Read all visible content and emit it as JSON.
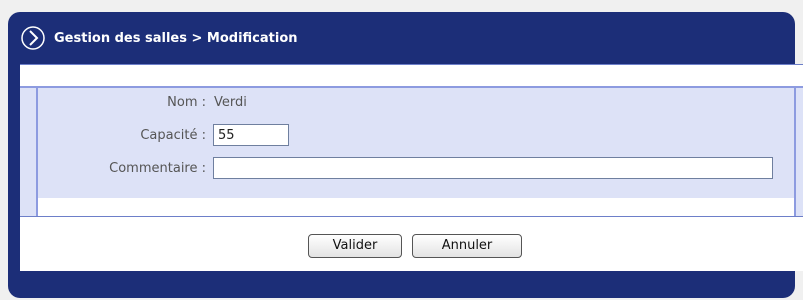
{
  "header": {
    "title": "Gestion des salles > Modification",
    "icon": "chevron-right-icon"
  },
  "form": {
    "nom_label": "Nom :",
    "nom_value": "Verdi",
    "capacite_label": "Capacité :",
    "capacite_value": "55",
    "commentaire_label": "Commentaire :",
    "commentaire_value": ""
  },
  "buttons": {
    "valider": "Valider",
    "annuler": "Annuler"
  },
  "colors": {
    "header_bg": "#1c2e78",
    "form_bg": "#dde2f7",
    "border": "#8d9be0"
  }
}
